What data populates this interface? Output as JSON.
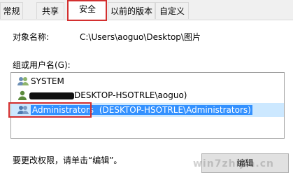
{
  "tabs": [
    {
      "label": "常规"
    },
    {
      "label": "共享"
    },
    {
      "label": "安全",
      "active": true
    },
    {
      "label": "以前的版本"
    },
    {
      "label": "自定义"
    }
  ],
  "object_name": {
    "label": "对象名称:",
    "value": "C:\\Users\\aoguo\\Desktop\\图片"
  },
  "groups": {
    "label": "组或用户名(G):",
    "items": [
      {
        "label": "SYSTEM",
        "icon": "users-group-icon"
      },
      {
        "label": "DESKTOP-HSOTRLE\\aoguo)",
        "icon": "user-icon",
        "redacted_prefix": true
      },
      {
        "label": "Administrators",
        "secondary": " (DESKTOP-HSOTRLE\\Administrators)",
        "icon": "users-group-icon",
        "selected": true
      }
    ]
  },
  "hint": "要更改权限，请单击“编辑”。",
  "edit_button": "编辑",
  "watermark": "win7zhijia.cn",
  "colors": {
    "highlight_box": "#d32f2f",
    "selection": "#3391ff",
    "selection_row": "#cce8ff"
  }
}
